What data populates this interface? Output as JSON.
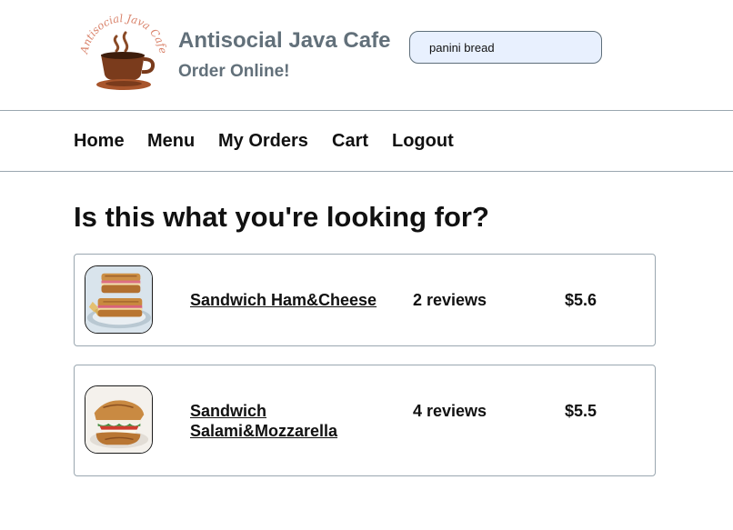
{
  "brand": {
    "logo_text": "Antisocial Java Cafe",
    "title": "Antisocial Java Cafe",
    "subtitle": "Order Online!"
  },
  "search": {
    "value": "panini bread",
    "icon": "search-field"
  },
  "nav": {
    "items": [
      {
        "label": "Home"
      },
      {
        "label": "Menu"
      },
      {
        "label": "My Orders"
      },
      {
        "label": "Cart"
      },
      {
        "label": "Logout"
      }
    ]
  },
  "main": {
    "heading": "Is this what you're looking for?",
    "results": [
      {
        "name": "Sandwich Ham&Cheese",
        "reviews": "2 reviews",
        "price": "$5.6",
        "image": "ham-cheese-sandwich-photo"
      },
      {
        "name": "Sandwich Salami&Mozzarella",
        "reviews": "4 reviews",
        "price": "$5.5",
        "image": "salami-mozzarella-sandwich-photo"
      }
    ]
  },
  "colors": {
    "brand_text": "#62707a",
    "divider": "#9aa7b0",
    "search_bg": "#e8f0fe",
    "logo_cup": "#7a3b1c",
    "logo_text": "#d9826a"
  }
}
